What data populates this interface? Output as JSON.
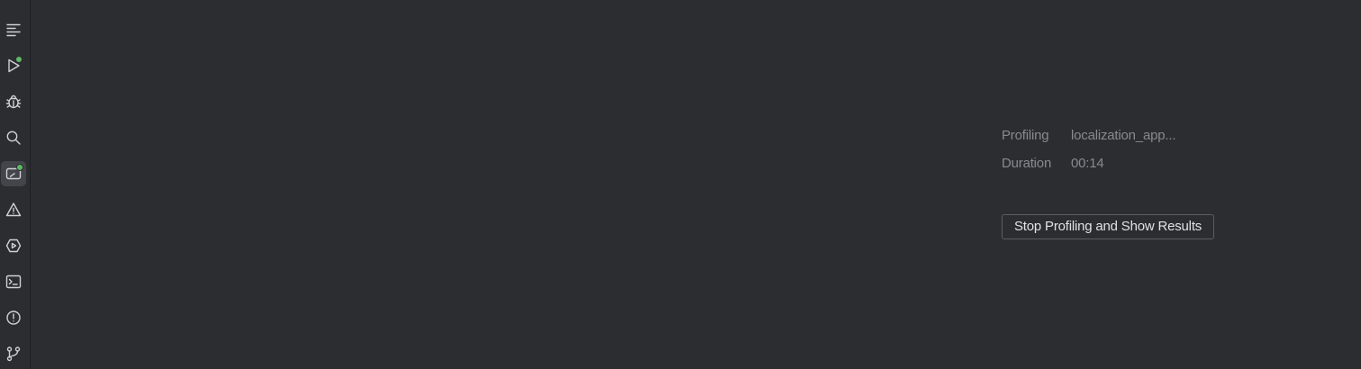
{
  "toolstrip": {
    "items": [
      {
        "name": "structure-icon",
        "active": false,
        "badge": false
      },
      {
        "name": "run-icon",
        "active": false,
        "badge": true,
        "badge_color": "#5fb865"
      },
      {
        "name": "debug-icon",
        "active": false,
        "badge": false
      },
      {
        "name": "search-icon",
        "active": false,
        "badge": false
      },
      {
        "name": "profiler-icon",
        "active": true,
        "badge": true,
        "badge_color": "#5fb865"
      },
      {
        "name": "problems-warning-icon",
        "active": false,
        "badge": false
      },
      {
        "name": "services-icon",
        "active": false,
        "badge": false
      },
      {
        "name": "terminal-icon",
        "active": false,
        "badge": false
      },
      {
        "name": "problems-icon",
        "active": false,
        "badge": false
      },
      {
        "name": "git-branch-icon",
        "active": false,
        "badge": false
      }
    ]
  },
  "profiling": {
    "profiling_label": "Profiling",
    "profiling_value": "localization_app...",
    "duration_label": "Duration",
    "duration_value": "00:14",
    "stop_button_label": "Stop Profiling and Show Results"
  },
  "colors": {
    "background": "#2b2d30",
    "muted_text": "#868a91",
    "button_text": "#dfe1e5",
    "badge_green": "#5fb865"
  }
}
